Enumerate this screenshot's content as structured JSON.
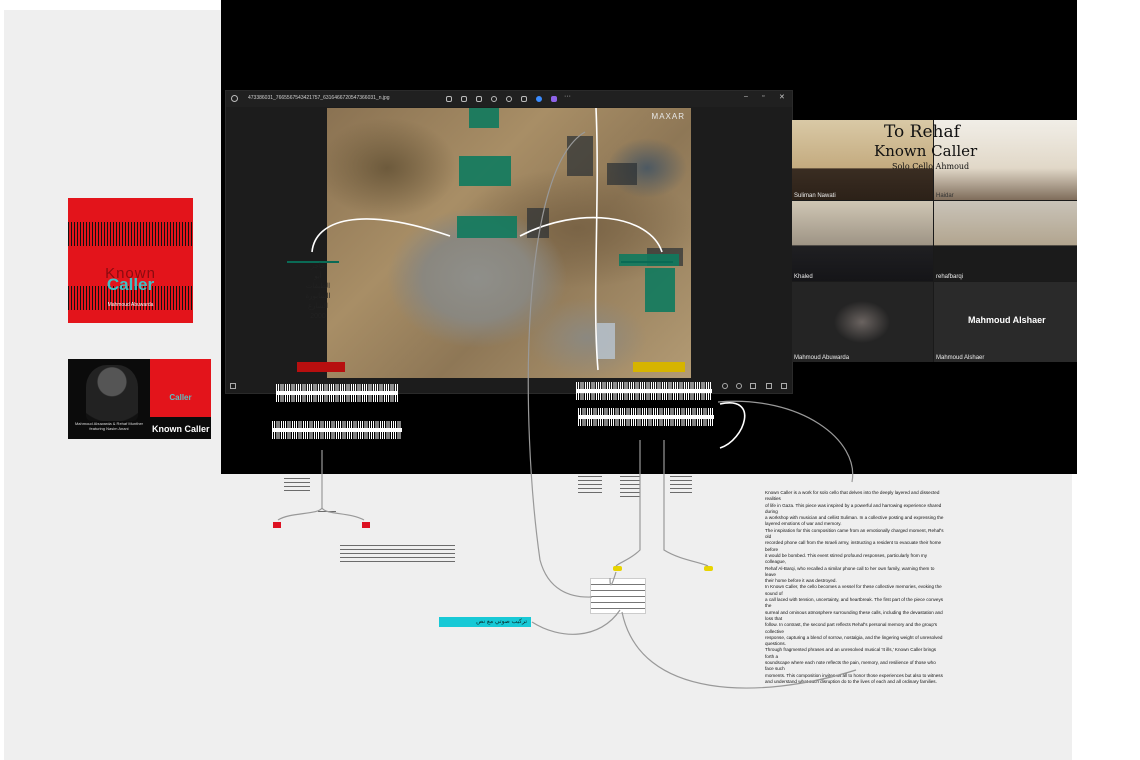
{
  "viewer": {
    "filename": "473386031_7665567543421757_6316466720547366031_n.jpg",
    "watermark": "MAXAR"
  },
  "covers": {
    "cover1": {
      "title_line1": "Known",
      "title_line2": "Caller",
      "subtitle": "Mahmoud Abuwarda"
    },
    "cover2": {
      "title": "Caller",
      "caption": "Mahmoud Abuwarda & Rehaf Munther featuring Nasim Anani",
      "label": "Known Caller"
    }
  },
  "zoom": {
    "participants": [
      "Suliman Nawati",
      "Haidar",
      "Khaled",
      "rehafbarqi",
      "Mahmoud Abuwarda",
      "Mahmoud Alshaer"
    ],
    "featured_name": "Mahmoud Alshaer",
    "handwriting": {
      "line1": "To Rehaf",
      "line2": "Known Caller",
      "line3": "Solo Cello   Ahmoud"
    }
  },
  "map_left_text": [
    "حاجز",
    "أبو",
    "الطبقات",
    "الشابورة",
    "الشارع",
    "2000"
  ],
  "cyan_label": "تركيب صوتي مع نص",
  "essay": [
    "Known Caller is a work for solo cello that delves into the deeply layered and dissected realities",
    "of life in Gaza. This piece was inspired by a powerful and harrowing experience shared during",
    "a workshop with musician and cellist Suliman. In a collective posting and expressing the",
    "layered emotions of war and memory.",
    "The inspiration for this composition came from an emotionally charged moment, Rehaf's old",
    "recorded phone call from the Israeli army, instructing a resident to evacuate their home before",
    "it would be bombed. This event stirred profound responses, particularly from my colleague,",
    "Rehaf Al-Barqi, who recalled a similar phone call to her own family, warning them to leave",
    "their home before it was destroyed.",
    "In Known Caller, the cello becomes a vessel for these collective memories, evoking the sound of",
    "a call laced with tension, uncertainty, and heartbreak. The first part of the piece conveys the",
    "surreal and ominous atmosphere surrounding these calls, including the devastation and loss that",
    "follow. In contrast, the second part reflects Rehaf's personal memory and the group's collective",
    "response, capturing a blend of sorrow, nostalgia, and the lingering weight of unresolved questions.",
    "Through fragmented phrases and an unresolved musical 'It ills,' Known Caller brings forth a",
    "soundscape where each note reflects the pain, memory, and resilience of those who face such",
    "moments. This composition invites us all to honor those experiences but also to witness",
    "and understand what such disruption do to the lives of each and all ordinary families."
  ]
}
